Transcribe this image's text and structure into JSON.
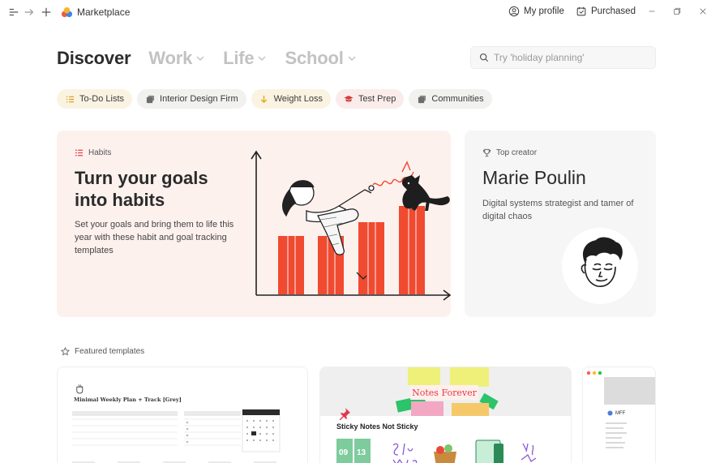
{
  "app": {
    "title": "Marketplace"
  },
  "header": {
    "my_profile": "My profile",
    "purchased": "Purchased"
  },
  "nav": {
    "tabs": [
      {
        "label": "Discover",
        "active": true
      },
      {
        "label": "Work",
        "active": false
      },
      {
        "label": "Life",
        "active": false
      },
      {
        "label": "School",
        "active": false
      }
    ]
  },
  "search": {
    "placeholder": "Try 'holiday planning'"
  },
  "chips": [
    {
      "label": "To-Do Lists",
      "icon": "checklist-icon",
      "bg": "#fbf3e2",
      "color": "#d29b1a"
    },
    {
      "label": "Interior Design Firm",
      "icon": "stack-icon",
      "bg": "#f1f1ef",
      "color": "#666666"
    },
    {
      "label": "Weight Loss",
      "icon": "arrow-down-icon",
      "bg": "#fbf3e2",
      "color": "#e0a81c"
    },
    {
      "label": "Test Prep",
      "icon": "graduation-cap-icon",
      "bg": "#fbecec",
      "color": "#d33b3b"
    },
    {
      "label": "Communities",
      "icon": "stack-icon",
      "bg": "#f1f1ef",
      "color": "#666666"
    }
  ],
  "hero": {
    "label": "Habits",
    "title": "Turn your goals into habits",
    "description": "Set your goals and bring them to life this year with these habit and goal tracking templates",
    "accent": "#f04a30"
  },
  "creator": {
    "label": "Top creator",
    "name": "Marie Poulin",
    "description": "Digital systems strategist and tamer of digital chaos"
  },
  "featured": {
    "label": "Featured templates",
    "cards": [
      {
        "title": "Minimal Weekly Plan + Track [Grey]"
      },
      {
        "banner": "Notes Forever",
        "title": "Sticky Notes Not Sticky"
      },
      {
        "title": "MFF"
      }
    ]
  },
  "colors": {
    "chart_red": "#f04a30",
    "sticky_yellow": "#eef07a",
    "sticky_green": "#2cc36b",
    "sticky_pink": "#f2a7c2"
  }
}
